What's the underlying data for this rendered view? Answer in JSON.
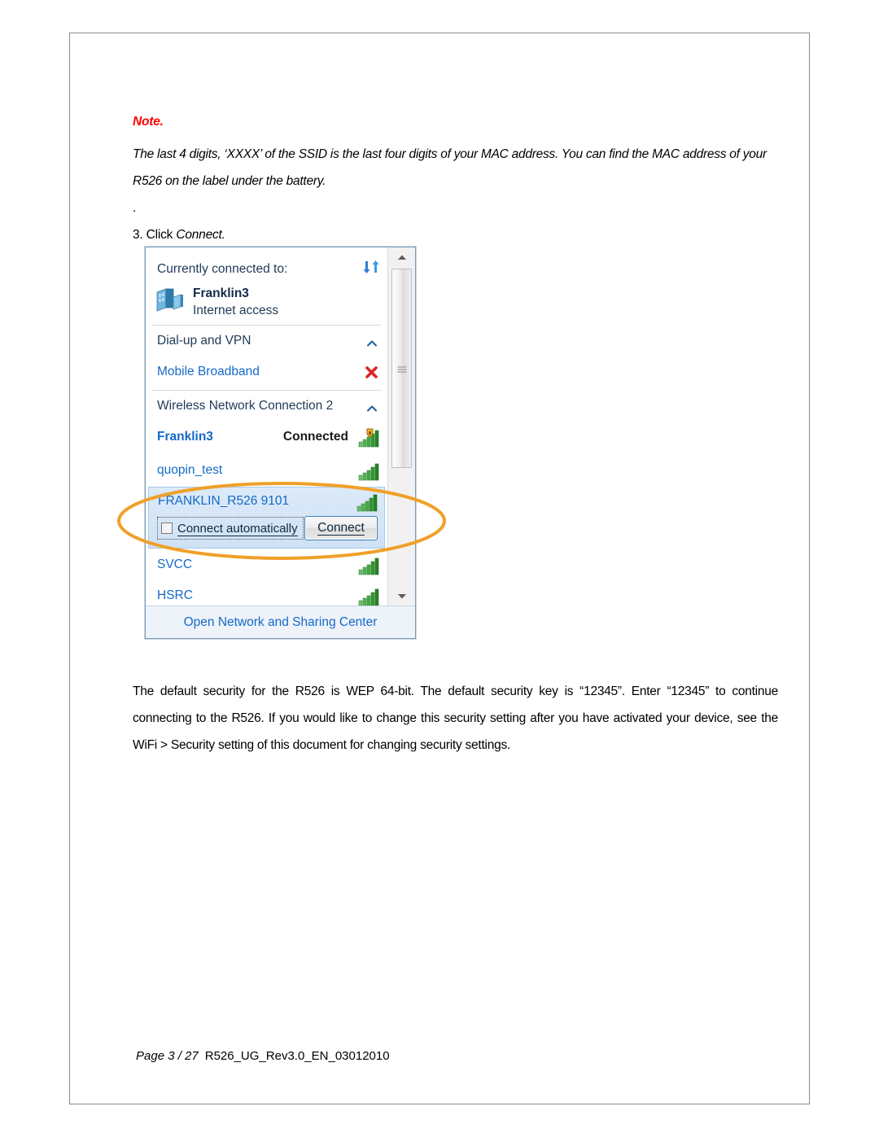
{
  "document": {
    "note_label": "Note.",
    "note_body": "The last 4 digits, ‘XXXX’ of the SSID is the last four digits of your MAC address. You can find the MAC address of your R526 on the label under the battery.",
    "dot_line": ".",
    "step_number": "3. Click ",
    "step_emphasis": "Connect.",
    "tail_paragraph": "The default security for the R526 is WEP 64-bit. The default security key is “12345”. Enter “12345” to continue connecting to the R526. If you would like to change this security setting after you have activated your device, see the WiFi > Security setting of this document for changing security settings.",
    "footer_page": "Page 3 / 27",
    "footer_file": "R526_UG_Rev3.0_EN_03012010"
  },
  "screenshot": {
    "flyout": {
      "currently_connected_title": "Currently connected to:",
      "refresh_icon": "refresh-icon",
      "active_connection": {
        "icon": "computer-network-icon",
        "name": "Franklin3",
        "status": "Internet access"
      },
      "groups": [
        {
          "label": "Dial-up and VPN",
          "chevron": "chevron-up-icon",
          "entries": [
            {
              "name": "Mobile Broadband",
              "icon": "red-x-icon",
              "state": ""
            }
          ]
        },
        {
          "label": "Wireless Network Connection 2",
          "chevron": "chevron-up-icon",
          "entries": [
            {
              "name": "Franklin3",
              "state": "Connected",
              "icon": "secured-signal-icon",
              "bold": true
            },
            {
              "name": "quopin_test",
              "state": "",
              "icon": "signal-icon",
              "bold": false
            },
            {
              "name": "FRANKLIN_R526 9101",
              "state": "",
              "icon": "signal-icon",
              "bold": false,
              "selected": true
            },
            {
              "name": "SVCC",
              "state": "",
              "icon": "signal-icon",
              "bold": false
            },
            {
              "name": "HSRC",
              "state": "",
              "icon": "signal-icon",
              "bold": false
            }
          ]
        }
      ],
      "selected_network": {
        "ssid": "FRANKLIN_R526 9101",
        "connect_automatically_label": "Connect automatically",
        "connect_automatically_checked": false,
        "connect_button_label": "Connect"
      },
      "footer_link": "Open Network and Sharing Center",
      "scrollbar": {
        "up_arrow": "scroll-up-arrow-icon",
        "down_arrow": "scroll-down-arrow-icon"
      }
    },
    "annotation": {
      "shape": "ellipse",
      "color": "#f0a028"
    }
  },
  "colors": {
    "note_red": "#ff0000",
    "link_blue": "#1569c7",
    "header_text": "#1f3a57",
    "signal_green": "#4ea24e",
    "highlight_orange": "#f0a028",
    "selection_blue": "#d3e5f7",
    "page_border": "#8a8a8a"
  }
}
